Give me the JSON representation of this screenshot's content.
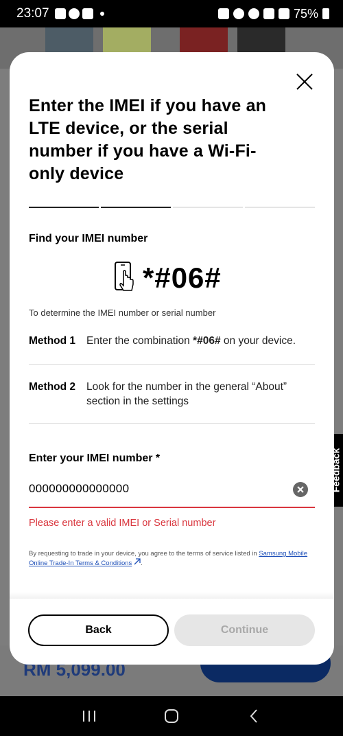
{
  "status_bar": {
    "time": "23:07",
    "battery": "75%"
  },
  "modal": {
    "title": "Enter the IMEI if you have an LTE device, or the serial number if you have a Wi-Fi-only device",
    "steps": [
      {
        "active": true
      },
      {
        "active": true
      },
      {
        "active": false
      },
      {
        "active": false
      }
    ],
    "find_title": "Find your IMEI number",
    "dial_code": "*#06#",
    "determine_text": "To determine the IMEI number or serial number",
    "methods": [
      {
        "label": "Method 1",
        "text_before": "Enter the combination ",
        "text_bold": "*#06#",
        "text_after": " on your device."
      },
      {
        "label": "Method 2",
        "text": "Look for the number in the general “About” section in the settings"
      }
    ],
    "imei_label": "Enter your IMEI number *",
    "imei_value": "000000000000000",
    "error_text": "Please enter a valid IMEI or Serial number",
    "terms_text": "By requesting to trade in your device, you agree to the terms of service listed in ",
    "terms_link": "Samsung Mobile Online Trade-In Terms & Conditions",
    "terms_end": ".",
    "back_label": "Back",
    "continue_label": "Continue"
  },
  "background": {
    "price": "RM 5,099.00"
  },
  "feedback_label": "Feedback",
  "colors": {
    "error": "#d9363e",
    "link": "#1d4fb8",
    "step_active": "#222222"
  }
}
